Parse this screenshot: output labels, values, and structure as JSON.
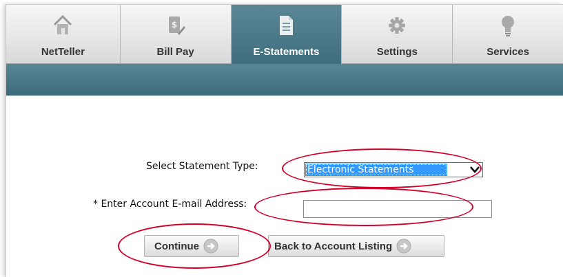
{
  "tabs": [
    {
      "label": "NetTeller",
      "icon": "home-icon",
      "active": false
    },
    {
      "label": "Bill Pay",
      "icon": "bill-pay-icon",
      "active": false
    },
    {
      "label": "E-Statements",
      "icon": "document-icon",
      "active": true
    },
    {
      "label": "Settings",
      "icon": "gear-icon",
      "active": false
    },
    {
      "label": "Services",
      "icon": "lightbulb-icon",
      "active": false
    }
  ],
  "form": {
    "statement_type_label": "Select Statement Type:",
    "statement_type_value": "Electronic Statements",
    "email_label": "* Enter Account E-mail Address:",
    "email_value": ""
  },
  "buttons": {
    "continue": "Continue",
    "back": "Back to Account Listing"
  },
  "colors": {
    "accent": "#4a7b8b",
    "annotation": "#d3002a",
    "selection": "#3399ff"
  }
}
